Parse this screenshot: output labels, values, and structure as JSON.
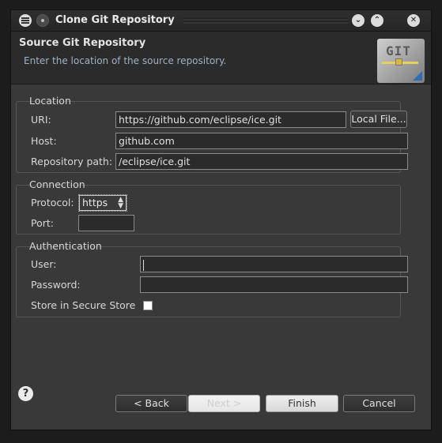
{
  "window": {
    "title": "Clone Git Repository",
    "minimize_icon": "chevron-down",
    "maximize_icon": "chevron-up",
    "close_icon": "close-x"
  },
  "header": {
    "title": "Source Git Repository",
    "subtitle": "Enter the location of the source repository.",
    "logo_text": "GIT"
  },
  "location": {
    "group_label": "Location",
    "uri_label": "URI:",
    "uri_value": "https://github.com/eclipse/ice.git",
    "local_file_button": "Local File...",
    "host_label": "Host:",
    "host_value": "github.com",
    "path_label": "Repository path:",
    "path_value": "/eclipse/ice.git"
  },
  "connection": {
    "group_label": "Connection",
    "protocol_label": "Protocol:",
    "protocol_value": "https",
    "port_label": "Port:",
    "port_value": ""
  },
  "authentication": {
    "group_label": "Authentication",
    "user_label": "User:",
    "user_value": "",
    "password_label": "Password:",
    "password_value": "",
    "secure_store_label": "Store in Secure Store",
    "secure_store_checked": false
  },
  "footer": {
    "help_icon": "?",
    "back_button": "< Back",
    "next_button": "Next >",
    "finish_button": "Finish",
    "cancel_button": "Cancel"
  }
}
